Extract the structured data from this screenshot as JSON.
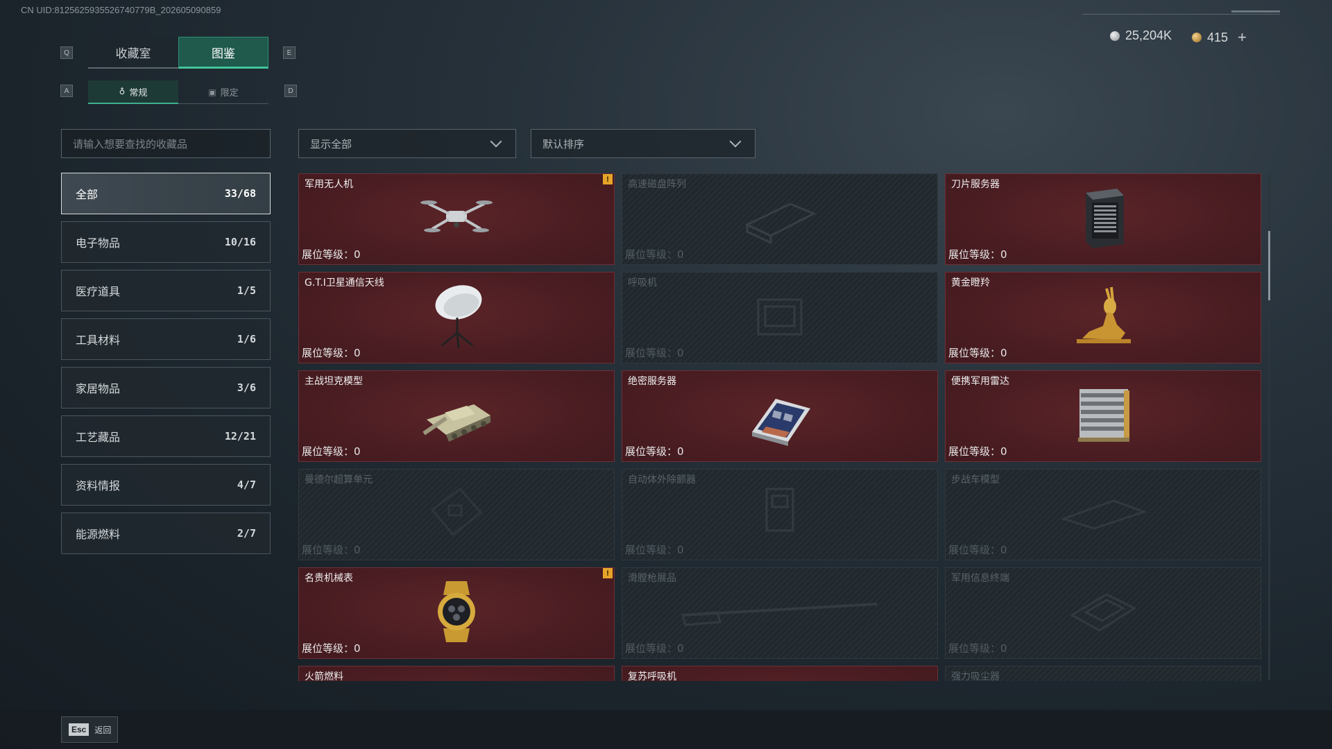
{
  "uid": "CN UID:8125625935526740779B_202605090859",
  "keys": {
    "prev_tab": "Q",
    "next_tab": "E",
    "prev_sub": "A",
    "next_sub": "D"
  },
  "tabs": [
    {
      "label": "收藏室"
    },
    {
      "label": "图鉴"
    }
  ],
  "subtabs": [
    {
      "label": "常规"
    },
    {
      "label": "限定"
    }
  ],
  "currency": {
    "silver": "25,204K",
    "gold": "415"
  },
  "search": {
    "placeholder": "请输入想要查找的收藏品"
  },
  "filters": {
    "show": "显示全部",
    "sort": "默认排序"
  },
  "categories": [
    {
      "label": "全部",
      "count": "33/68"
    },
    {
      "label": "电子物品",
      "count": "10/16"
    },
    {
      "label": "医疗道具",
      "count": "1/5"
    },
    {
      "label": "工具材料",
      "count": "1/6"
    },
    {
      "label": "家居物品",
      "count": "3/6"
    },
    {
      "label": "工艺藏品",
      "count": "12/21"
    },
    {
      "label": "资料情报",
      "count": "4/7"
    },
    {
      "label": "能源燃料",
      "count": "2/7"
    }
  ],
  "level_label": "展位等级：",
  "items": [
    {
      "name": "军用无人机",
      "level": "0",
      "owned": true,
      "warn": true,
      "icon": "drone-icon"
    },
    {
      "name": "高速磁盘阵列",
      "level": "0",
      "owned": false,
      "icon": "disk-array-icon"
    },
    {
      "name": "刀片服务器",
      "level": "0",
      "owned": true,
      "icon": "blade-server-icon"
    },
    {
      "name": "G.T.I卫星通信天线",
      "level": "0",
      "owned": true,
      "icon": "satellite-dish-icon"
    },
    {
      "name": "呼吸机",
      "level": "0",
      "owned": false,
      "icon": "ventilator-icon"
    },
    {
      "name": "黄金瞪羚",
      "level": "0",
      "owned": true,
      "icon": "golden-gazelle-icon"
    },
    {
      "name": "主战坦克模型",
      "level": "0",
      "owned": true,
      "icon": "tank-model-icon"
    },
    {
      "name": "绝密服务器",
      "level": "0",
      "owned": true,
      "icon": "secret-server-icon"
    },
    {
      "name": "便携军用雷达",
      "level": "0",
      "owned": true,
      "icon": "radar-icon"
    },
    {
      "name": "曼德尔超算单元",
      "level": "0",
      "owned": false,
      "icon": "supercompute-unit-icon"
    },
    {
      "name": "自动体外除颤器",
      "level": "0",
      "owned": false,
      "icon": "defibrillator-icon"
    },
    {
      "name": "步战车模型",
      "level": "0",
      "owned": false,
      "icon": "ifv-model-icon"
    },
    {
      "name": "名贵机械表",
      "level": "0",
      "owned": true,
      "warn": true,
      "icon": "watch-icon"
    },
    {
      "name": "滑膛枪展品",
      "level": "0",
      "owned": false,
      "icon": "musket-icon"
    },
    {
      "name": "军用信息终端",
      "level": "0",
      "owned": false,
      "icon": "info-terminal-icon"
    },
    {
      "name": "火箭燃料",
      "level": "",
      "owned": true,
      "icon": "rocket-fuel-icon"
    },
    {
      "name": "复苏呼吸机",
      "level": "",
      "owned": true,
      "icon": "resuscitator-icon"
    },
    {
      "name": "强力吸尘器",
      "level": "",
      "owned": false,
      "icon": "vacuum-icon"
    }
  ],
  "footer": {
    "key": "Esc",
    "label": "返回"
  },
  "colors": {
    "accent": "#43c59b",
    "owned_card": "#4a1d22",
    "warn": "#e6a428"
  }
}
